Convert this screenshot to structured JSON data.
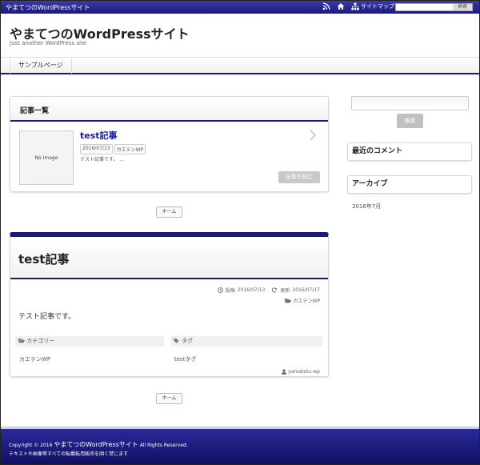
{
  "topbar": {
    "site_name": "やまてつのWordPressサイト",
    "sitemap_label": "サイトマップ",
    "search_button": "検索"
  },
  "header": {
    "title": "やまてつのWordPressサイト",
    "tagline": "Just another WordPress site"
  },
  "nav": {
    "items": [
      {
        "label": "サンプルページ"
      }
    ]
  },
  "list": {
    "heading": "記事一覧",
    "post": {
      "no_image": "No Image",
      "title": "test記事",
      "date": "2016/07/13",
      "category": "カエテンWP",
      "excerpt": "テスト記事です。 ...",
      "read_more": "記事を読む"
    },
    "home_button": "ホーム"
  },
  "article": {
    "title": "test記事",
    "posted_label": "投稿",
    "posted_date": "2016/07/13",
    "updated_label": "更新",
    "updated_date": "2016/07/17",
    "category": "カエテンWP",
    "body": "テスト記事です。",
    "category_heading": "カテゴリー",
    "category_value": "カエテンWP",
    "tag_heading": "タグ",
    "tag_value": "testタグ",
    "author": "yamatetu-wp",
    "home_button": "ホーム"
  },
  "sidebar": {
    "search_button": "検索",
    "recent_comments": "最近のコメント",
    "archives": "アーカイブ",
    "archive_item": "2016年7月"
  },
  "footer": {
    "copyright_prefix": "Copyright © 2016",
    "site_name": "やまてつのWordPressサイト",
    "copyright_suffix": "All Rights Reserved.",
    "notice": "テキストや画像等すべての転載転用販売を固く禁じます"
  },
  "colors": {
    "brand": "#1a1a7a",
    "accent_link": "#1a1a9a"
  }
}
